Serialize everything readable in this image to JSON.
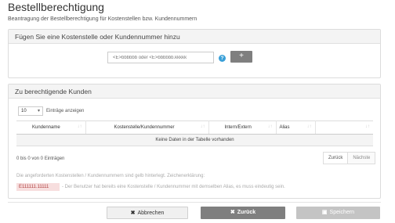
{
  "page": {
    "title": "Bestellberechtigung",
    "subtitle": "Beantragung der Bestellberechtigung für Kostenstellen bzw. Kundennummern"
  },
  "add_panel": {
    "heading": "Fügen Sie eine Kostenstelle oder Kundennummer hinzu",
    "input_placeholder": "<E>bbbbbb oder <E>bbbbbb.kkkkk",
    "info_icon": "?",
    "add_button_label": "+"
  },
  "customers_panel": {
    "heading": "Zu berechtigende Kunden",
    "page_length_value": "10",
    "page_length_label": "Einträge anzeigen",
    "columns": [
      "Kundenname",
      "Kostenstelle/Kundennummer",
      "Intern/Extern",
      "Alias",
      ""
    ],
    "sort_icon": "↓↑",
    "empty_message": "Keine Daten in der Tabelle vorhanden",
    "info": "0 bis 0 von 0 Einträgen",
    "pager": {
      "prev": "Zurück",
      "next": "Nächste"
    },
    "note": "Die angeforderten Kostenstellen / Kundennummern sind gelb hinterlegt. Zeichenerklärung:",
    "sample_value": "E111111.11111",
    "sample_desc": "- Der Benutzer hat bereits eine Kostenstelle / Kundennummer mit demselben Alias, es muss eindeutig sein."
  },
  "footer": {
    "cancel_icon": "✖",
    "cancel_label": "Abbrechen",
    "back_icon": "✖",
    "back_label": "Zurück",
    "save_icon": "▣",
    "save_label": "Speichern"
  }
}
